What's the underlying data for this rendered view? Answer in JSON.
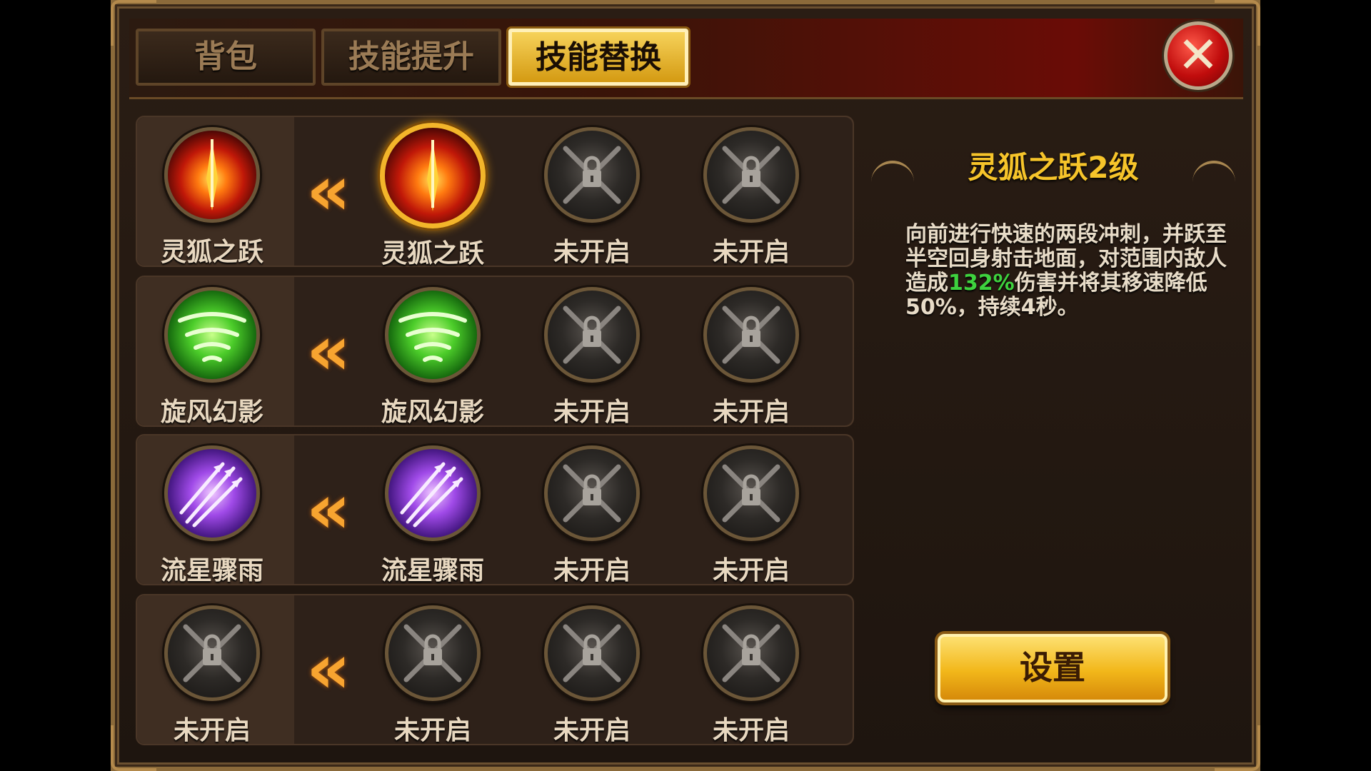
{
  "tabs": [
    {
      "label": "背包",
      "active": false
    },
    {
      "label": "技能提升",
      "active": false
    },
    {
      "label": "技能替换",
      "active": true
    }
  ],
  "close_icon": "close-x-icon",
  "rows": [
    {
      "current": {
        "name": "灵狐之跃",
        "icon": "fox-leap-skill-icon"
      },
      "options": [
        {
          "name": "灵狐之跃",
          "icon": "fox-leap-skill-icon",
          "selected": true
        },
        {
          "name": "未开启",
          "icon": "locked-chain-icon"
        },
        {
          "name": "未开启",
          "icon": "locked-chain-icon"
        }
      ]
    },
    {
      "current": {
        "name": "旋风幻影",
        "icon": "whirlwind-skill-icon"
      },
      "options": [
        {
          "name": "旋风幻影",
          "icon": "whirlwind-skill-icon"
        },
        {
          "name": "未开启",
          "icon": "locked-chain-icon"
        },
        {
          "name": "未开启",
          "icon": "locked-chain-icon"
        }
      ]
    },
    {
      "current": {
        "name": "流星骤雨",
        "icon": "meteor-rain-skill-icon"
      },
      "options": [
        {
          "name": "流星骤雨",
          "icon": "meteor-rain-skill-icon"
        },
        {
          "name": "未开启",
          "icon": "locked-chain-icon"
        },
        {
          "name": "未开启",
          "icon": "locked-chain-icon"
        }
      ]
    },
    {
      "current": {
        "name": "未开启",
        "icon": "locked-chain-icon"
      },
      "options": [
        {
          "name": "未开启",
          "icon": "locked-chain-icon"
        },
        {
          "name": "未开启",
          "icon": "locked-chain-icon"
        },
        {
          "name": "未开启",
          "icon": "locked-chain-icon"
        }
      ]
    }
  ],
  "arrow_icon": "double-chevron-left-icon",
  "info": {
    "title": "灵狐之跃2级",
    "desc_part1": "向前进行快速的两段冲刺，并跃至半空回身射击地面，对范围内敌人造成",
    "desc_highlight": "132%",
    "desc_part2": "伤害并将其移速降低50%，持续4秒。"
  },
  "setup_button": "设置",
  "colors": {
    "highlight": "#3ed23e",
    "title": "#f6c42a",
    "accent_gold": "#f2b71a"
  }
}
